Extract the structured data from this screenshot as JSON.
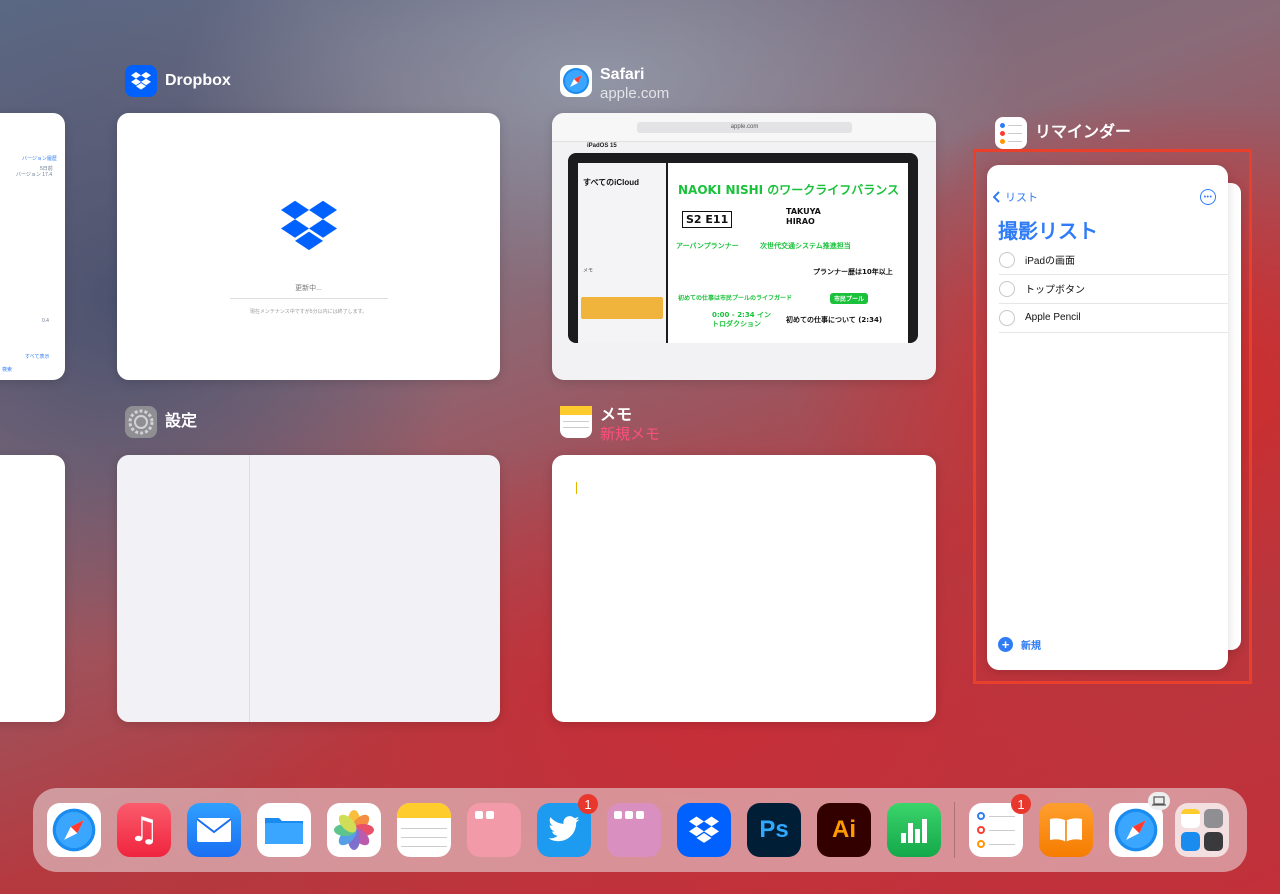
{
  "cards": {
    "dropbox": {
      "title": "Dropbox",
      "status": "更新中...",
      "note": "現在メンテナンス中ですが5分以内には終了します。"
    },
    "safari": {
      "title": "Safari",
      "subtitle": "apple.com",
      "url": "apple.com",
      "page_heading": "iPadOS 15",
      "sidebar_title": "すべてのiCloud",
      "notes_header": "メモ",
      "handwriting": [
        "NAOKI NISHI のワークライフバランス",
        "S2 E11",
        "TAKUYA HIRAO",
        "アーバンプランナー",
        "次世代交通システム推進担当",
        "プランナー歴は10年以上",
        "初めての仕事は市民プールのライフガード",
        "市民プール",
        "0:00 - 2:34 イントロダクション",
        "初めての仕事について (2:34)"
      ]
    },
    "settings": {
      "title": "設定"
    },
    "notes": {
      "title": "メモ",
      "subtitle": "新規メモ"
    },
    "reminders": {
      "title": "リマインダー",
      "back_label": "リスト",
      "list_title": "撮影リスト",
      "items": [
        "iPadの画面",
        "トップボタン",
        "Apple Pencil"
      ],
      "new_label": "新規"
    },
    "partial_left": {
      "texts": [
        "バージョン履歴",
        "5日前",
        "バージョン 17.4",
        "0.4",
        "すべて表示",
        "検索"
      ]
    }
  },
  "dock": {
    "items": [
      {
        "name": "safari-app",
        "label": "Safari"
      },
      {
        "name": "music-app",
        "label": "ミュージック"
      },
      {
        "name": "mail-app",
        "label": "メール"
      },
      {
        "name": "files-app",
        "label": "ファイル"
      },
      {
        "name": "photos-app",
        "label": "写真"
      },
      {
        "name": "notes-app",
        "label": "メモ"
      },
      {
        "name": "folder-app",
        "label": "フォルダ"
      },
      {
        "name": "twitter-app",
        "label": "Twitter",
        "badge": "1"
      },
      {
        "name": "folder2-app",
        "label": "フォルダ"
      },
      {
        "name": "dropbox-app",
        "label": "Dropbox"
      },
      {
        "name": "photoshop-app",
        "label": "Ps"
      },
      {
        "name": "illustrator-app",
        "label": "Ai"
      },
      {
        "name": "numbers-app",
        "label": "Numbers"
      },
      {
        "name": "reminders-app",
        "label": "リマインダー",
        "badge": "1"
      },
      {
        "name": "books-app",
        "label": "ブック"
      },
      {
        "name": "safari-recent-app",
        "label": "Safari"
      },
      {
        "name": "app-library",
        "label": "App Library"
      }
    ]
  },
  "colors": {
    "highlight": "#e8402a",
    "accent": "#2f7cf6",
    "notes_accent": "#ff3b6b"
  }
}
